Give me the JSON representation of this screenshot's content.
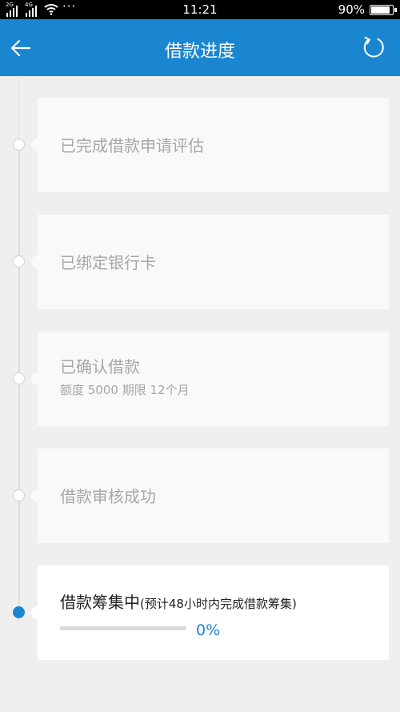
{
  "status_bar": {
    "net1": "2G",
    "net2": "4G",
    "dots": "···",
    "time": "11:21",
    "battery_pct": "90%",
    "battery_level": 0.9
  },
  "header": {
    "title": "借款进度",
    "back_icon": "back-arrow-icon",
    "refresh_icon": "refresh-icon"
  },
  "steps": [
    {
      "label": "已完成借款申请评估"
    },
    {
      "label": "已绑定银行卡"
    },
    {
      "label": "已确认借款",
      "sub": "额度 5000 期限  12个月"
    },
    {
      "label": "借款审核成功"
    },
    {
      "label": "借款筹集中",
      "note": "(预计48小时内完成借款筹集)",
      "progress_text": "0%",
      "progress_value": 0
    }
  ],
  "colors": {
    "accent": "#1a86cf",
    "inactive_text": "#a7a7a7",
    "background": "#efeff0"
  }
}
